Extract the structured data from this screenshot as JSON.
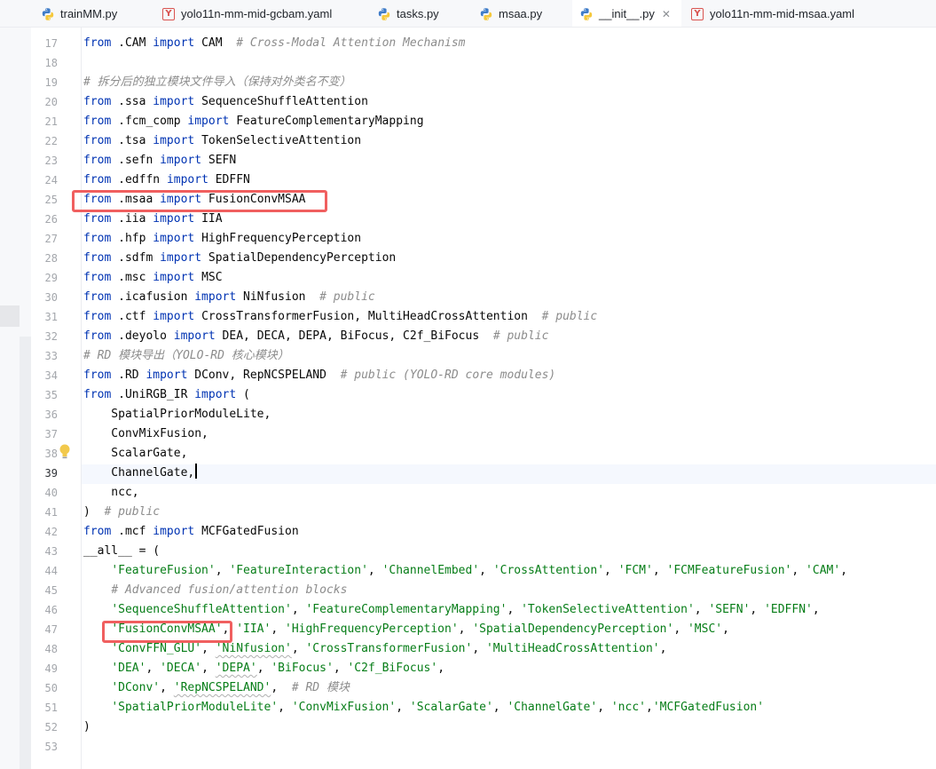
{
  "tabs": [
    {
      "label": "trainMM.py",
      "icon": "python-file-icon",
      "active": false
    },
    {
      "label": "yolo11n-mm-mid-gcbam.yaml",
      "icon": "yaml-file-icon",
      "active": false
    },
    {
      "label": "tasks.py",
      "icon": "python-file-icon",
      "active": false
    },
    {
      "label": "msaa.py",
      "icon": "python-file-icon",
      "active": false
    },
    {
      "label": "__init__.py",
      "icon": "python-file-icon",
      "active": true,
      "close": "✕"
    },
    {
      "label": "yolo11n-mm-mid-msaa.yaml",
      "icon": "yaml-file-icon",
      "active": false
    }
  ],
  "yaml_icon_letter": "Y",
  "current_line": 39,
  "colors": {
    "keyword": "#0033b3",
    "string": "#067d17",
    "comment": "#8c8c8c",
    "highlight_box": "#f05f5f",
    "active_tab": "#3574f0"
  },
  "lines": [
    {
      "n": 17,
      "tokens": [
        [
          "k",
          "from"
        ],
        [
          "n",
          " .CAM "
        ],
        [
          "k",
          "import"
        ],
        [
          "n",
          " CAM  "
        ],
        [
          "c",
          "# Cross-Modal Attention Mechanism"
        ]
      ]
    },
    {
      "n": 18,
      "tokens": []
    },
    {
      "n": 19,
      "tokens": [
        [
          "c",
          "# 拆分后的独立模块文件导入（保持对外类名不变）"
        ]
      ]
    },
    {
      "n": 20,
      "tokens": [
        [
          "k",
          "from"
        ],
        [
          "n",
          " .ssa "
        ],
        [
          "k",
          "import"
        ],
        [
          "n",
          " SequenceShuffleAttention"
        ]
      ]
    },
    {
      "n": 21,
      "tokens": [
        [
          "k",
          "from"
        ],
        [
          "n",
          " .fcm_comp "
        ],
        [
          "k",
          "import"
        ],
        [
          "n",
          " FeatureComplementaryMapping"
        ]
      ]
    },
    {
      "n": 22,
      "tokens": [
        [
          "k",
          "from"
        ],
        [
          "n",
          " .tsa "
        ],
        [
          "k",
          "import"
        ],
        [
          "n",
          " TokenSelectiveAttention"
        ]
      ]
    },
    {
      "n": 23,
      "tokens": [
        [
          "k",
          "from"
        ],
        [
          "n",
          " .sefn "
        ],
        [
          "k",
          "import"
        ],
        [
          "n",
          " SEFN"
        ]
      ]
    },
    {
      "n": 24,
      "tokens": [
        [
          "k",
          "from"
        ],
        [
          "n",
          " .edffn "
        ],
        [
          "k",
          "import"
        ],
        [
          "n",
          " EDFFN"
        ]
      ]
    },
    {
      "n": 25,
      "tokens": [
        [
          "k",
          "from"
        ],
        [
          "n",
          " .msaa "
        ],
        [
          "k",
          "import"
        ],
        [
          "n",
          " FusionConvMSAA"
        ]
      ]
    },
    {
      "n": 26,
      "tokens": [
        [
          "k",
          "from"
        ],
        [
          "n",
          " .iia "
        ],
        [
          "k",
          "import"
        ],
        [
          "n",
          " IIA"
        ]
      ]
    },
    {
      "n": 27,
      "tokens": [
        [
          "k",
          "from"
        ],
        [
          "n",
          " .hfp "
        ],
        [
          "k",
          "import"
        ],
        [
          "n",
          " HighFrequencyPerception"
        ]
      ]
    },
    {
      "n": 28,
      "tokens": [
        [
          "k",
          "from"
        ],
        [
          "n",
          " .sdfm "
        ],
        [
          "k",
          "import"
        ],
        [
          "n",
          " SpatialDependencyPerception"
        ]
      ]
    },
    {
      "n": 29,
      "tokens": [
        [
          "k",
          "from"
        ],
        [
          "n",
          " .msc "
        ],
        [
          "k",
          "import"
        ],
        [
          "n",
          " MSC"
        ]
      ]
    },
    {
      "n": 30,
      "tokens": [
        [
          "k",
          "from"
        ],
        [
          "n",
          " .icafusion "
        ],
        [
          "k",
          "import"
        ],
        [
          "n",
          " NiNfusion  "
        ],
        [
          "c",
          "# public"
        ]
      ]
    },
    {
      "n": 31,
      "tokens": [
        [
          "k",
          "from"
        ],
        [
          "n",
          " .ctf "
        ],
        [
          "k",
          "import"
        ],
        [
          "n",
          " CrossTransformerFusion, MultiHeadCrossAttention  "
        ],
        [
          "c",
          "# public"
        ]
      ]
    },
    {
      "n": 32,
      "tokens": [
        [
          "k",
          "from"
        ],
        [
          "n",
          " .deyolo "
        ],
        [
          "k",
          "import"
        ],
        [
          "n",
          " DEA, DECA, DEPA, BiFocus, C2f_BiFocus  "
        ],
        [
          "c",
          "# public"
        ]
      ]
    },
    {
      "n": 33,
      "tokens": [
        [
          "c",
          "# RD 模块导出（YOLO-RD 核心模块）"
        ]
      ]
    },
    {
      "n": 34,
      "tokens": [
        [
          "k",
          "from"
        ],
        [
          "n",
          " .RD "
        ],
        [
          "k",
          "import"
        ],
        [
          "n",
          " DConv, RepNCSPELAND  "
        ],
        [
          "c",
          "# public (YOLO-RD core modules)"
        ]
      ]
    },
    {
      "n": 35,
      "tokens": [
        [
          "k",
          "from"
        ],
        [
          "n",
          " .UniRGB_IR "
        ],
        [
          "k",
          "import"
        ],
        [
          "n",
          " ("
        ]
      ]
    },
    {
      "n": 36,
      "tokens": [
        [
          "n",
          "    SpatialPriorModuleLite,"
        ]
      ]
    },
    {
      "n": 37,
      "tokens": [
        [
          "n",
          "    ConvMixFusion,"
        ]
      ]
    },
    {
      "n": 38,
      "tokens": [
        [
          "n",
          "    ScalarGate,"
        ]
      ]
    },
    {
      "n": 39,
      "tokens": [
        [
          "n",
          "    ChannelGate,"
        ]
      ],
      "caret": true
    },
    {
      "n": 40,
      "tokens": [
        [
          "n",
          "    ncc,"
        ]
      ]
    },
    {
      "n": 41,
      "tokens": [
        [
          "n",
          ")  "
        ],
        [
          "c",
          "# public"
        ]
      ]
    },
    {
      "n": 42,
      "tokens": [
        [
          "k",
          "from"
        ],
        [
          "n",
          " .mcf "
        ],
        [
          "k",
          "import"
        ],
        [
          "n",
          " MCFGatedFusion"
        ]
      ]
    },
    {
      "n": 43,
      "tokens": [
        [
          "n",
          "__all__ = ("
        ]
      ]
    },
    {
      "n": 44,
      "tokens": [
        [
          "n",
          "    "
        ],
        [
          "s",
          "'FeatureFusion'"
        ],
        [
          "n",
          ", "
        ],
        [
          "s",
          "'FeatureInteraction'"
        ],
        [
          "n",
          ", "
        ],
        [
          "s",
          "'ChannelEmbed'"
        ],
        [
          "n",
          ", "
        ],
        [
          "s",
          "'CrossAttention'"
        ],
        [
          "n",
          ", "
        ],
        [
          "s",
          "'FCM'"
        ],
        [
          "n",
          ", "
        ],
        [
          "s",
          "'FCMFeatureFusion'"
        ],
        [
          "n",
          ", "
        ],
        [
          "s",
          "'CAM'"
        ],
        [
          "n",
          ","
        ]
      ]
    },
    {
      "n": 45,
      "tokens": [
        [
          "n",
          "    "
        ],
        [
          "c",
          "# Advanced fusion/attention blocks"
        ]
      ]
    },
    {
      "n": 46,
      "tokens": [
        [
          "n",
          "    "
        ],
        [
          "s",
          "'SequenceShuffleAttention'"
        ],
        [
          "n",
          ", "
        ],
        [
          "s",
          "'FeatureComplementaryMapping'"
        ],
        [
          "n",
          ", "
        ],
        [
          "s",
          "'TokenSelectiveAttention'"
        ],
        [
          "n",
          ", "
        ],
        [
          "s",
          "'SEFN'"
        ],
        [
          "n",
          ", "
        ],
        [
          "s",
          "'EDFFN'"
        ],
        [
          "n",
          ","
        ]
      ]
    },
    {
      "n": 47,
      "tokens": [
        [
          "n",
          "    "
        ],
        [
          "s",
          "'FusionConvMSAA'"
        ],
        [
          "n",
          ", "
        ],
        [
          "s",
          "'IIA'"
        ],
        [
          "n",
          ", "
        ],
        [
          "s",
          "'HighFrequencyPerception'"
        ],
        [
          "n",
          ", "
        ],
        [
          "s",
          "'SpatialDependencyPerception'"
        ],
        [
          "n",
          ", "
        ],
        [
          "s",
          "'MSC'"
        ],
        [
          "n",
          ","
        ]
      ]
    },
    {
      "n": 48,
      "tokens": [
        [
          "n",
          "    "
        ],
        [
          "s",
          "'ConvFFN_GLU'"
        ],
        [
          "n",
          ", "
        ],
        [
          "s",
          "'NiNfusion'"
        ],
        [
          "n",
          ", "
        ],
        [
          "s",
          "'CrossTransformerFusion'"
        ],
        [
          "n",
          ", "
        ],
        [
          "s",
          "'MultiHeadCrossAttention'"
        ],
        [
          "n",
          ","
        ]
      ]
    },
    {
      "n": 49,
      "tokens": [
        [
          "n",
          "    "
        ],
        [
          "s",
          "'DEA'"
        ],
        [
          "n",
          ", "
        ],
        [
          "s",
          "'DECA'"
        ],
        [
          "n",
          ", "
        ],
        [
          "s",
          "'DEPA'"
        ],
        [
          "n",
          ", "
        ],
        [
          "s",
          "'BiFocus'"
        ],
        [
          "n",
          ", "
        ],
        [
          "s",
          "'C2f_BiFocus'"
        ],
        [
          "n",
          ","
        ]
      ]
    },
    {
      "n": 50,
      "tokens": [
        [
          "n",
          "    "
        ],
        [
          "s",
          "'DConv'"
        ],
        [
          "n",
          ", "
        ],
        [
          "s",
          "'RepNCSPELAND'"
        ],
        [
          "n",
          ",  "
        ],
        [
          "c",
          "# RD 模块"
        ]
      ]
    },
    {
      "n": 51,
      "tokens": [
        [
          "n",
          "    "
        ],
        [
          "s",
          "'SpatialPriorModuleLite'"
        ],
        [
          "n",
          ", "
        ],
        [
          "s",
          "'ConvMixFusion'"
        ],
        [
          "n",
          ", "
        ],
        [
          "s",
          "'ScalarGate'"
        ],
        [
          "n",
          ", "
        ],
        [
          "s",
          "'ChannelGate'"
        ],
        [
          "n",
          ", "
        ],
        [
          "s",
          "'ncc'"
        ],
        [
          "n",
          ","
        ],
        [
          "s",
          "'MCFGatedFusion'"
        ]
      ]
    },
    {
      "n": 52,
      "tokens": [
        [
          "n",
          ")"
        ]
      ]
    },
    {
      "n": 53,
      "tokens": []
    }
  ]
}
